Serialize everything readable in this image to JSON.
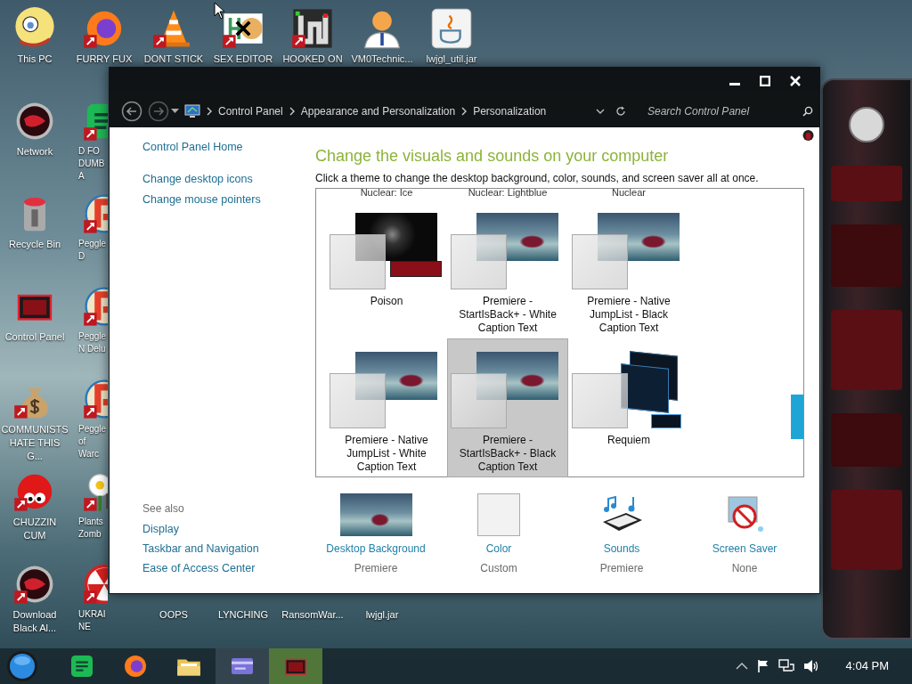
{
  "desktop": {
    "columns": [
      [
        {
          "label": "This PC",
          "kind": "cartoon",
          "shortcut": false
        },
        {
          "label": "Network",
          "kind": "orb",
          "shortcut": false
        },
        {
          "label": "Recycle Bin",
          "kind": "bin",
          "shortcut": false
        },
        {
          "label": "Control Panel",
          "kind": "panel",
          "shortcut": false
        },
        {
          "label": "COMMUNISTS HATE THIS G...",
          "kind": "moneybag",
          "shortcut": true
        },
        {
          "label": "CHUZZIN CUM",
          "kind": "fuzzball",
          "shortcut": true
        },
        {
          "label": "Download Black Al...",
          "kind": "orb",
          "shortcut": true
        }
      ],
      [
        {
          "label": "FURRY FUX",
          "kind": "firefox",
          "shortcut": true
        },
        {
          "label": "D FO DUMBA",
          "kind": "notes",
          "shortcut": true
        },
        {
          "label": "Peggle D",
          "kind": "peggle",
          "shortcut": true
        },
        {
          "label": "Peggle N Delu",
          "kind": "peggle",
          "shortcut": true
        },
        {
          "label": "Peggle of Warc",
          "kind": "peggle",
          "shortcut": true
        },
        {
          "label": "Plants Zomb",
          "kind": "flower",
          "shortcut": true
        },
        {
          "label": "UKRAINE",
          "kind": "radiation",
          "shortcut": true
        }
      ]
    ],
    "top_row": [
      {
        "label": "DONT STICK",
        "kind": "cone",
        "shortcut": true
      },
      {
        "label": "SEX EDITOR",
        "kind": "hex",
        "shortcut": true
      },
      {
        "label": "HOOKED ON",
        "kind": "maze",
        "shortcut": true
      },
      {
        "label": "VM0Technic...",
        "kind": "doctor",
        "shortcut": false
      },
      {
        "label": "lwjgl_util.jar",
        "kind": "java",
        "shortcut": false
      }
    ],
    "bottom_row": [
      {
        "label": "OOPS"
      },
      {
        "label": "LYNCHING"
      },
      {
        "label": "RansomWar..."
      },
      {
        "label": "lwjgl.jar"
      }
    ]
  },
  "window": {
    "breadcrumbs": [
      "Control Panel",
      "Appearance and Personalization",
      "Personalization"
    ],
    "search": {
      "placeholder": "Search Control Panel"
    },
    "sidebar": {
      "links": [
        "Control Panel Home",
        "Change desktop icons",
        "Change mouse pointers"
      ],
      "see_also_title": "See also",
      "see_also": [
        "Display",
        "Taskbar and Navigation",
        "Ease of Access Center"
      ]
    },
    "heading": "Change the visuals and sounds on your computer",
    "description": "Click a theme to change the desktop background, color, sounds, and screen saver all at once.",
    "cut_theme_names": [
      "Nuclear: Ice",
      "Nuclear: Lightblue",
      "Nuclear"
    ],
    "themes": [
      {
        "name": "Poison",
        "kind": "alien",
        "selected": false
      },
      {
        "name": "Premiere - StartIsBack+ - White Caption Text",
        "kind": "premiere",
        "selected": false
      },
      {
        "name": "Premiere - Native JumpList - Black Caption Text",
        "kind": "premiere",
        "selected": false
      },
      {
        "name": "Premiere - Native JumpList - White Caption Text",
        "kind": "premiere",
        "selected": false
      },
      {
        "name": "Premiere - StartIsBack+ - Black Caption Text",
        "kind": "premiere",
        "selected": true
      },
      {
        "name": "Requiem",
        "kind": "requiem",
        "selected": false
      }
    ],
    "settings": [
      {
        "label": "Desktop Background",
        "value": "Premiere",
        "kind": "background"
      },
      {
        "label": "Color",
        "value": "Custom",
        "kind": "color"
      },
      {
        "label": "Sounds",
        "value": "Premiere",
        "kind": "sounds"
      },
      {
        "label": "Screen Saver",
        "value": "None",
        "kind": "screensaver"
      }
    ]
  },
  "taskbar": {
    "apps": [
      {
        "kind": "notes",
        "selected": false
      },
      {
        "kind": "firefox",
        "selected": false
      },
      {
        "kind": "folder",
        "selected": false
      },
      {
        "kind": "card",
        "selected": true
      },
      {
        "kind": "panel",
        "selected": false
      }
    ],
    "clock": "4:04 PM"
  }
}
